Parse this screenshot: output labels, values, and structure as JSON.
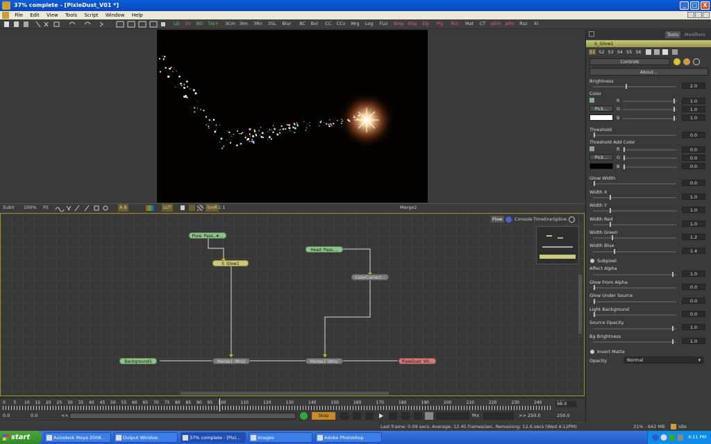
{
  "window": {
    "title": "37% complete - [PixieDust_V01 *]",
    "controls": [
      "_",
      "□",
      "X"
    ]
  },
  "menu": [
    "File",
    "Edit",
    "View",
    "Tools",
    "Script",
    "Window",
    "Help"
  ],
  "toolbar": {
    "buttons": [
      {
        "label": "LD",
        "tone": "green"
      },
      {
        "label": "SV",
        "tone": "red"
      },
      {
        "label": "BG",
        "tone": "green"
      },
      {
        "label": "Txt+",
        "tone": "green"
      },
      {
        "label": "3Cm"
      },
      {
        "label": "3Im"
      },
      {
        "label": "3Rn"
      },
      {
        "label": "3SL"
      },
      {
        "label": "Blur"
      },
      {
        "label": "BC"
      },
      {
        "label": "Bol"
      },
      {
        "label": "CC"
      },
      {
        "label": "CCv"
      },
      {
        "label": "Mrg"
      },
      {
        "label": "Log"
      },
      {
        "label": "FLU"
      },
      {
        "label": "Bmp",
        "tone": "pink"
      },
      {
        "label": "BSp",
        "tone": "pink"
      },
      {
        "label": "Elp",
        "tone": "pink"
      },
      {
        "label": "Ply",
        "tone": "pink"
      },
      {
        "label": "Rct",
        "tone": "pink"
      },
      {
        "label": "Mat"
      },
      {
        "label": "CT"
      },
      {
        "label": "pEm",
        "tone": "pink"
      },
      {
        "label": "pRn",
        "tone": "pink"
      },
      {
        "label": "Rsz"
      },
      {
        "label": "XI"
      }
    ]
  },
  "viewer": {
    "subv_label": "SubV",
    "zoom_label": "100%",
    "fit_label": "Fit",
    "lut_label": "LUT",
    "smr_label": "SmR",
    "abc_label": "A B",
    "current_node": "Merge2"
  },
  "flow_tabs": [
    {
      "label": "Flow",
      "active": true
    },
    {
      "label": "Console"
    },
    {
      "label": "Timeline"
    },
    {
      "label": "Spline"
    }
  ],
  "nodes": {
    "pixie_pass": "Pixie_Pass..#...",
    "s_glow": "S_Glow1",
    "head_pass": "Head_Pass....",
    "color_correct": "ColorCorrect...",
    "background": "Background1",
    "merge1": "Merge1 (Mrg)",
    "merge2": "Merge2 (Mrg)",
    "saver": "PixieDust_V0..."
  },
  "timeline": {
    "ticks": [
      "0",
      "5",
      "10",
      "15",
      "20",
      "25",
      "30",
      "35",
      "40",
      "45",
      "50",
      "55",
      "60",
      "65",
      "70",
      "75",
      "80",
      "85",
      "90",
      "95",
      "100",
      "110",
      "120",
      "130",
      "140",
      "150",
      "160",
      "170",
      "180",
      "190",
      "200",
      "210",
      "220",
      "230",
      "240",
      "250"
    ],
    "current": "98.0",
    "start": "0.0",
    "render_start": "0.0",
    "end": "250.0",
    "render_end": "250.0",
    "stop_label": "Stop",
    "prx_label": "Prx"
  },
  "status": {
    "message": "Last frame: 0.09 secs, Average: 12.45 frames/sec, Remaining: 12.6 secs (Wed 4:12PM)",
    "memory": "31% - 642 MB",
    "state": "Idle"
  },
  "taskbar": {
    "start_label": "start",
    "tasks": [
      {
        "label": "Autodesk Maya 2008..."
      },
      {
        "label": "Output Window"
      },
      {
        "label": "37% complete - [Pixi...",
        "active": true
      },
      {
        "label": "images"
      },
      {
        "label": "Adobe Photoshop"
      }
    ],
    "clock": "4:11 PM"
  },
  "panel": {
    "tabs": [
      "Tools",
      "Modifiers"
    ],
    "tool_name": "S_Glow1",
    "sub_tabs": [
      "S1",
      "S2",
      "S3",
      "S4",
      "S5",
      "S6"
    ],
    "controls_label": "Controls",
    "about_label": "About...",
    "pick_label": "Pick...",
    "params": {
      "brightness": {
        "label": "Brightness",
        "value": "2.0"
      },
      "color": {
        "label": "Color",
        "r": "1.0",
        "g": "1.0",
        "b": "1.0",
        "swatch": "#ffffff"
      },
      "threshold": {
        "label": "Threshold",
        "value": "0.0"
      },
      "threshold_add": {
        "label": "Threshold Add Color",
        "r": "0.0",
        "g": "0.0",
        "b": "0.0",
        "swatch": "#000000"
      },
      "glow_width": {
        "label": "Glow Width",
        "value": "0.0"
      },
      "width_x": {
        "label": "Width X",
        "value": "1.0"
      },
      "width_y": {
        "label": "Width Y",
        "value": "1.0"
      },
      "width_red": {
        "label": "Width Red",
        "value": "1.0"
      },
      "width_green": {
        "label": "Width Green",
        "value": "1.2"
      },
      "width_blue": {
        "label": "Width Blue",
        "value": "1.4"
      },
      "subpixel": {
        "label": "Subpixel"
      },
      "affect_alpha": {
        "label": "Affect Alpha",
        "value": "1.0"
      },
      "glow_from_alpha": {
        "label": "Glow From Alpha",
        "value": "0.0"
      },
      "glow_under_source": {
        "label": "Glow Under Source",
        "value": "0.0"
      },
      "light_background": {
        "label": "Light Background",
        "value": "0.0"
      },
      "source_opacity": {
        "label": "Source Opacity",
        "value": "1.0"
      },
      "bg_brightness": {
        "label": "Bg Brightness",
        "value": "1.0"
      },
      "invert_matte": {
        "label": "Invert Matte"
      },
      "opacity": {
        "label": "Opacity",
        "value": "Normal"
      }
    }
  }
}
